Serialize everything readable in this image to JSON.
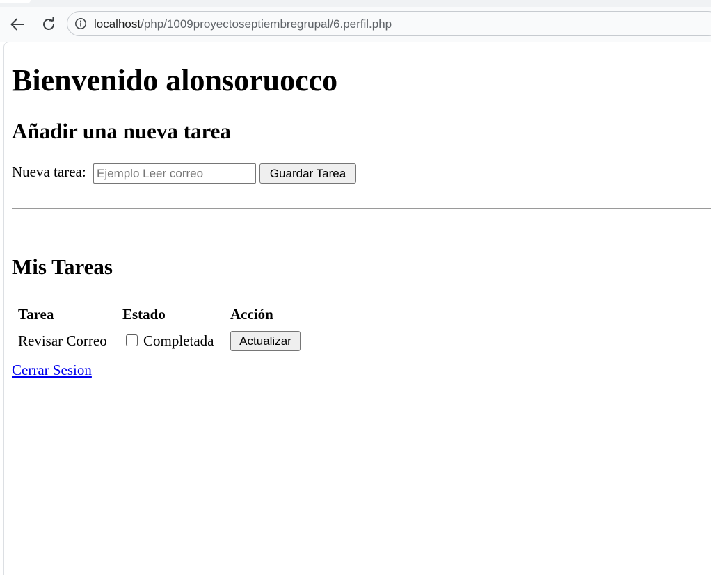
{
  "browser": {
    "url_host": "localhost",
    "url_path": "/php/1009proyectoseptiembregrupal/6.perfil.php",
    "icons": {
      "back": "arrow-left-icon",
      "reload": "reload-icon",
      "site_info": "info-circle-icon"
    }
  },
  "page": {
    "welcome_title": "Bienvenido alonsoruocco",
    "add_task_heading": "Añadir una nueva tarea",
    "form": {
      "label": "Nueva tarea:",
      "input_value": "",
      "input_placeholder": "Ejemplo Leer correo",
      "save_button": "Guardar Tarea"
    },
    "tasks_heading": "Mis Tareas",
    "table": {
      "headers": [
        "Tarea",
        "Estado",
        "Acción"
      ],
      "rows": [
        {
          "task": "Revisar Correo",
          "status_label": "Completada",
          "completed": false,
          "action_button": "Actualizar"
        }
      ]
    },
    "logout_link": "Cerrar Sesion",
    "colors": {
      "link": "#0000ee",
      "button_bg": "#efefef"
    }
  }
}
